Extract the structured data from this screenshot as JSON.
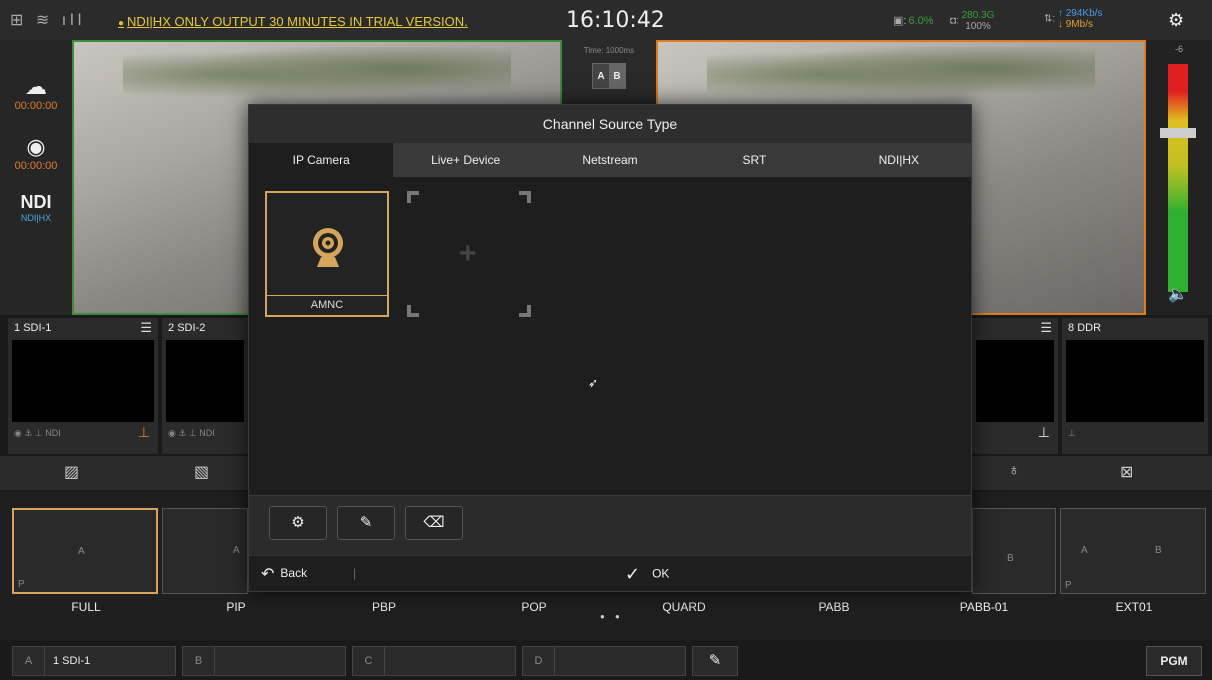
{
  "topbar": {
    "trial_notice": "NDI|HX ONLY OUTPUT 30 MINUTES IN TRIAL VERSION.",
    "clock": "16:10:42",
    "cpu": "6.0%",
    "disk_size": "280.3G",
    "disk_pct": "100%",
    "net_up": "294Kb/s",
    "net_down": "9Mb/s"
  },
  "leftrail": {
    "stream_time": "00:00:00",
    "record_time": "00:00:00",
    "ndi_label": "NDI|HX"
  },
  "transition": {
    "time": "Time: 1000ms",
    "a": "A",
    "b": "B"
  },
  "meter": {
    "db_top": "-6"
  },
  "sources": [
    {
      "num": "1",
      "name": "SDI-1"
    },
    {
      "num": "2",
      "name": "SDI-2"
    },
    {
      "num": "",
      "name": ""
    },
    {
      "num": "8",
      "name": "DDR"
    }
  ],
  "source_foot_left": "NDI",
  "presets": [
    {
      "name": "FULL",
      "a": "A",
      "p": "P"
    },
    {
      "name": "PIP",
      "a": "A"
    },
    {
      "name": "PBP"
    },
    {
      "name": "POP"
    },
    {
      "name": "QUARD"
    },
    {
      "name": "PABB"
    },
    {
      "name": "PABB-01",
      "b": "B"
    },
    {
      "name": "EXT01",
      "a": "A",
      "b": "B",
      "p": "P"
    }
  ],
  "bottom": {
    "slots": [
      {
        "key": "A",
        "value": "1 SDI-1"
      },
      {
        "key": "B",
        "value": ""
      },
      {
        "key": "C",
        "value": ""
      },
      {
        "key": "D",
        "value": ""
      }
    ],
    "pgm": "PGM"
  },
  "modal": {
    "title": "Channel Source Type",
    "tabs": [
      "IP Camera",
      "Live+ Device",
      "Netstream",
      "SRT",
      "NDI|HX"
    ],
    "active_tab": "IP Camera",
    "card_name": "AMNC",
    "back": "Back",
    "ok": "OK"
  },
  "colors": {
    "accent": "#d4a55a",
    "pvw_border": "#3c8c3c",
    "pgm_border": "#e07a20"
  }
}
